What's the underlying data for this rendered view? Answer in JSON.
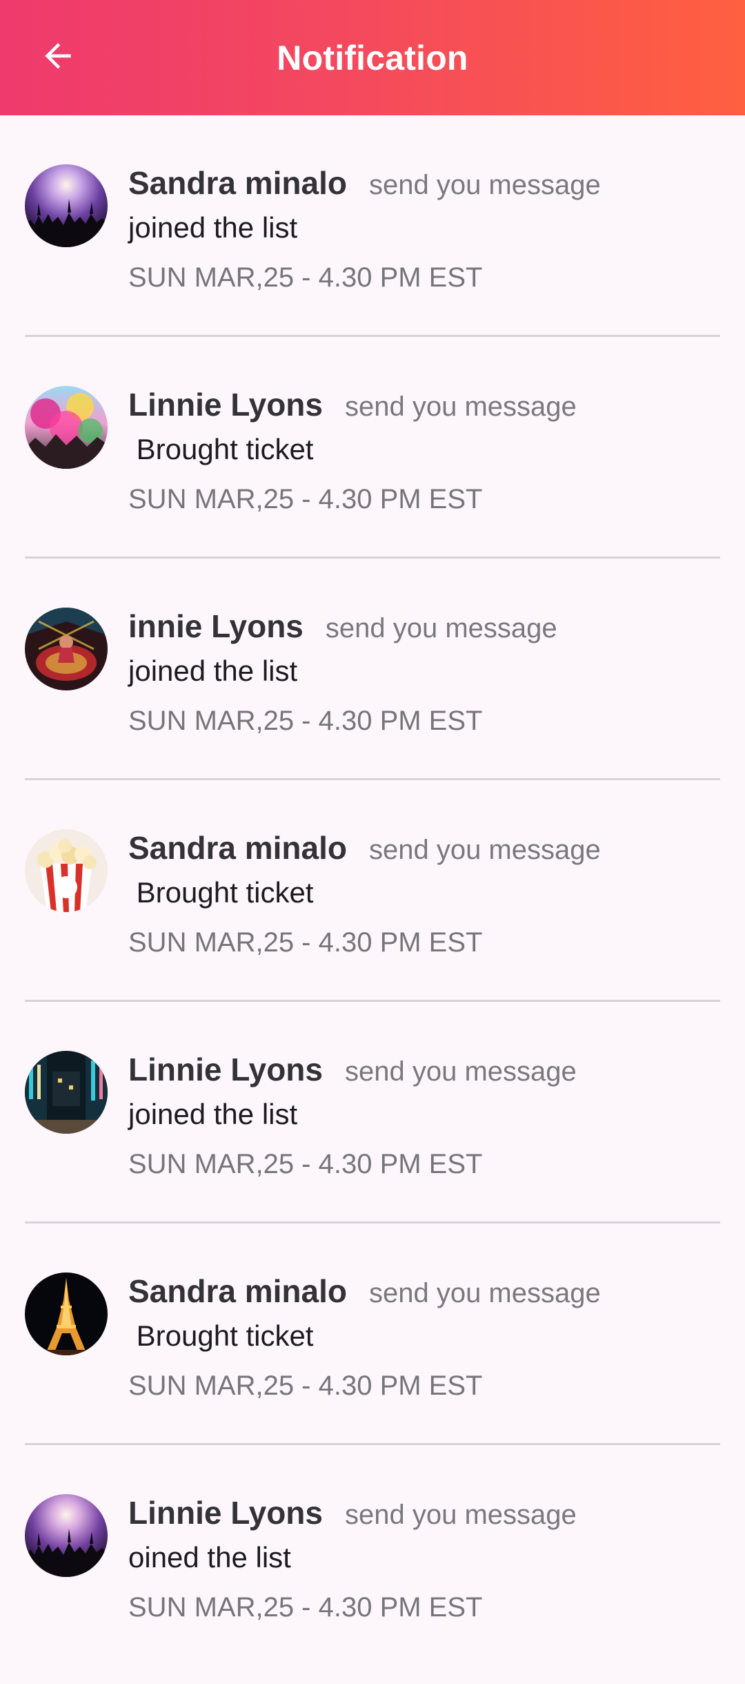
{
  "header": {
    "title": "Notification",
    "back_icon": "arrow-left-icon"
  },
  "colors": {
    "header_gradient_start": "#ee3a6d",
    "header_gradient_end": "#ff6040",
    "background": "#fdf7fc",
    "divider": "#d6d2d6"
  },
  "notifications": [
    {
      "name": "Sandra minalo",
      "action": "send you message",
      "detail": "joined the list",
      "time": "SUN MAR,25 - 4.30 PM EST",
      "avatar": "concert-crowd-image"
    },
    {
      "name": "Linnie Lyons",
      "action": "send you message",
      "detail": " Brought ticket",
      "time": "SUN MAR,25 - 4.30 PM EST",
      "avatar": "color-festival-image"
    },
    {
      "name": "innie Lyons",
      "action": "send you message",
      "detail": "joined the list",
      "time": "SUN MAR,25 - 4.30 PM EST",
      "avatar": "dancer-image"
    },
    {
      "name": "Sandra minalo",
      "action": "send you message",
      "detail": " Brought ticket",
      "time": "SUN MAR,25 - 4.30 PM EST",
      "avatar": "popcorn-image"
    },
    {
      "name": "Linnie Lyons",
      "action": "send you message",
      "detail": "joined the list",
      "time": "SUN MAR,25 - 4.30 PM EST",
      "avatar": "city-street-night-image"
    },
    {
      "name": "Sandra minalo",
      "action": "send you message",
      "detail": " Brought ticket",
      "time": "SUN MAR,25 - 4.30 PM EST",
      "avatar": "eiffel-tower-night-image"
    },
    {
      "name": "Linnie Lyons",
      "action": "send you message",
      "detail": "oined the list",
      "time": "SUN MAR,25 - 4.30 PM EST",
      "avatar": "concert-crowd-image"
    }
  ]
}
